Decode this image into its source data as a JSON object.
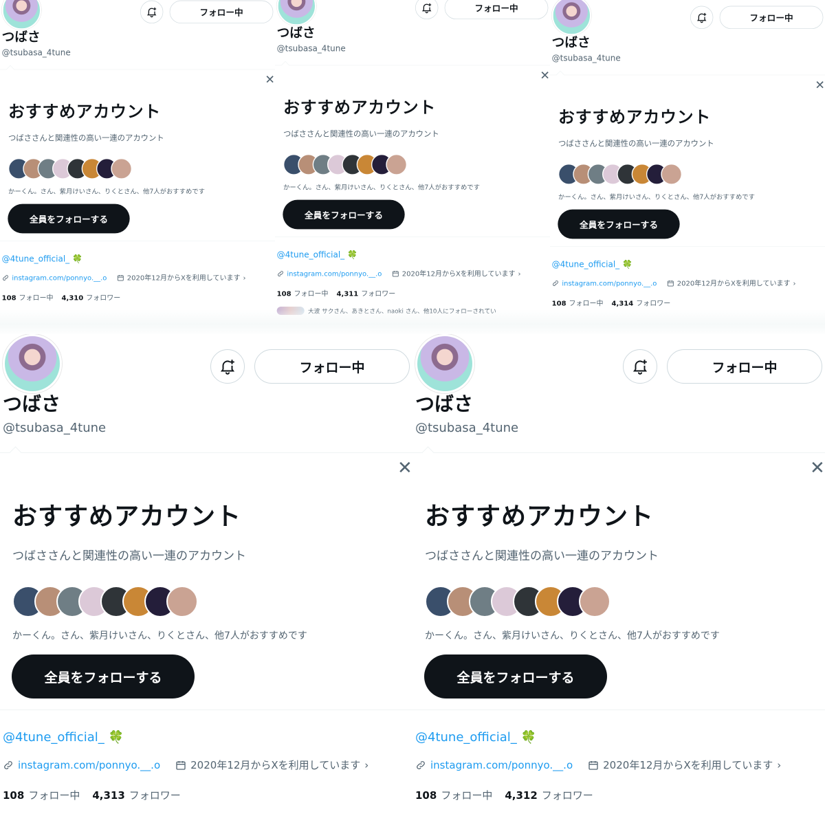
{
  "profile": {
    "name": "つばさ",
    "handle": "@tsubasa_4tune",
    "follow_button": "フォロー中",
    "bio_link": "@4tune_official_ 🍀",
    "website": "instagram.com/ponnyo.__.o",
    "joined": "2020年12月からXを利用しています",
    "following_count": "108",
    "following_label": "フォロー中",
    "followers_label": "フォロワー"
  },
  "recommend": {
    "title": "おすすめアカウント",
    "subtitle": "つばささんと関連性の高い一連のアカウント",
    "names": "かーくん。さん、紫月けいさん、りくとさん、他7人がおすすめです",
    "follow_all": "全員をフォローする",
    "close": "✕"
  },
  "tiles": [
    {
      "followers_count": "4,310"
    },
    {
      "followers_count": "4,311",
      "followed_by": "大波 サクさん、あきとさん、naoki さん、他10人にフォローされてい"
    },
    {
      "followers_count": "4,314"
    },
    {
      "followers_count": "4,313"
    },
    {
      "followers_count": "4,312"
    }
  ],
  "colors": {
    "accent": "#1d9bf0",
    "primary_button": "#0f1419",
    "secondary_text": "#536471"
  },
  "icons": [
    "bell-plus-icon",
    "close-icon",
    "link-icon",
    "calendar-icon",
    "chevron-right-icon"
  ]
}
